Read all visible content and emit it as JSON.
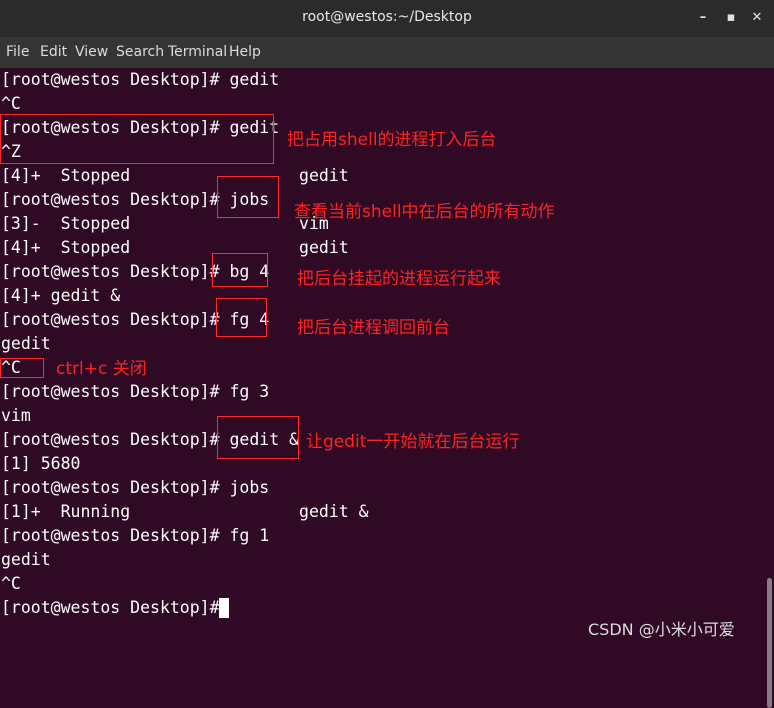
{
  "window": {
    "title": "root@westos:~/Desktop",
    "minimize_glyph": "–",
    "maximize_glyph": "▪",
    "close_glyph": "✕"
  },
  "menu": {
    "file": "File",
    "edit": "Edit",
    "view": "View",
    "search": "Search",
    "terminal": "Terminal",
    "help": "Help"
  },
  "terminal": {
    "lines": [
      "[root@westos Desktop]# gedit",
      "^C",
      "[root@westos Desktop]# gedit",
      "^Z",
      "[4]+  Stopped                 gedit",
      "[root@westos Desktop]# jobs",
      "[3]-  Stopped                 vim",
      "[4]+  Stopped                 gedit",
      "[root@westos Desktop]# bg 4",
      "[4]+ gedit &",
      "[root@westos Desktop]# fg 4",
      "gedit",
      "^C",
      "[root@westos Desktop]# fg 3",
      "vim",
      "[root@westos Desktop]# gedit &",
      "[1] 5680",
      "[root@westos Desktop]# jobs",
      "[1]+  Running                 gedit &",
      "[root@westos Desktop]# fg 1",
      "gedit",
      "^C",
      "[root@westos Desktop]# "
    ]
  },
  "annotations": {
    "a1": "把占用shell的进程打入后台",
    "a2": "查看当前shell中在后台的所有动作",
    "a3": "把后台挂起的进程运行起来",
    "a4": "把后台进程调回前台",
    "a5": "ctrl+c 关闭",
    "a6": "让gedit一开始就在后台运行"
  },
  "watermark": "CSDN @小米小可爱",
  "colors": {
    "terminal_bg": "#300a24",
    "text": "#ffffff",
    "annotation": "#ff2222"
  }
}
